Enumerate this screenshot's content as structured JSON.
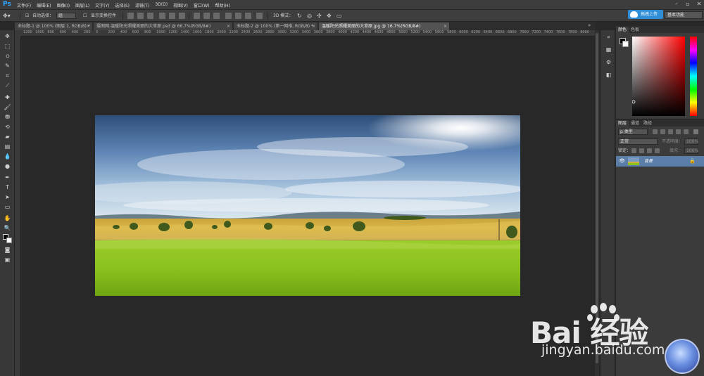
{
  "app": {
    "logo": "Ps"
  },
  "menu": [
    "文件(F)",
    "编辑(E)",
    "图像(I)",
    "图层(L)",
    "文字(Y)",
    "选择(S)",
    "滤镜(T)",
    "3D(D)",
    "视图(V)",
    "窗口(W)",
    "帮助(H)"
  ],
  "options": {
    "auto_select_label": "自动选择：",
    "auto_select_value": "组",
    "transform_label": "显示变换控件",
    "mode_3d_label": "3D 模式："
  },
  "upload_button": "拖拽上传",
  "workspace": "基本功能",
  "tabs": [
    {
      "label": "未标题-1 @ 100% (图层 1, RGB/8) *"
    },
    {
      "label": "摄图网-温暖阳光照耀美丽的大草原.psd @ 66.7%(RGB/8#)"
    },
    {
      "label": "未标题-2 @ 100% (第一网格, RGB/8) *"
    },
    {
      "label": "温暖阳光照耀美丽的大草原.jpg @ 16.7%(RGB/8#)"
    }
  ],
  "ruler_ticks": [
    "1200",
    "1000",
    "800",
    "600",
    "400",
    "200",
    "0",
    "200",
    "400",
    "600",
    "800",
    "1000",
    "1200",
    "1400",
    "1600",
    "1800",
    "2000",
    "2200",
    "2400",
    "2600",
    "2800",
    "3000",
    "3200",
    "3400",
    "3600",
    "3800",
    "4000",
    "4200",
    "4400",
    "4600",
    "4800",
    "5000",
    "5200",
    "5400",
    "5600",
    "5800",
    "6000",
    "6200",
    "6400",
    "6600",
    "6800",
    "7000",
    "7200",
    "7400",
    "7600",
    "7800",
    "8000"
  ],
  "color_panel": {
    "tabs": [
      "颜色",
      "色板"
    ]
  },
  "layers_panel": {
    "tabs": [
      "图层",
      "通道",
      "路径"
    ],
    "kind_filter": "p 类型",
    "blend_mode": "正常",
    "opacity_label": "不透明度：",
    "opacity_value": "100%",
    "lock_label": "锁定：",
    "fill_label": "填充：",
    "fill_value": "100%",
    "layer_name": "背景"
  },
  "watermark": {
    "brand": "Bai 经验",
    "url": "jingyan.baidu.com"
  },
  "colors": {
    "accent": "#2f8ed6",
    "layer_selected": "#5a7ea8"
  }
}
